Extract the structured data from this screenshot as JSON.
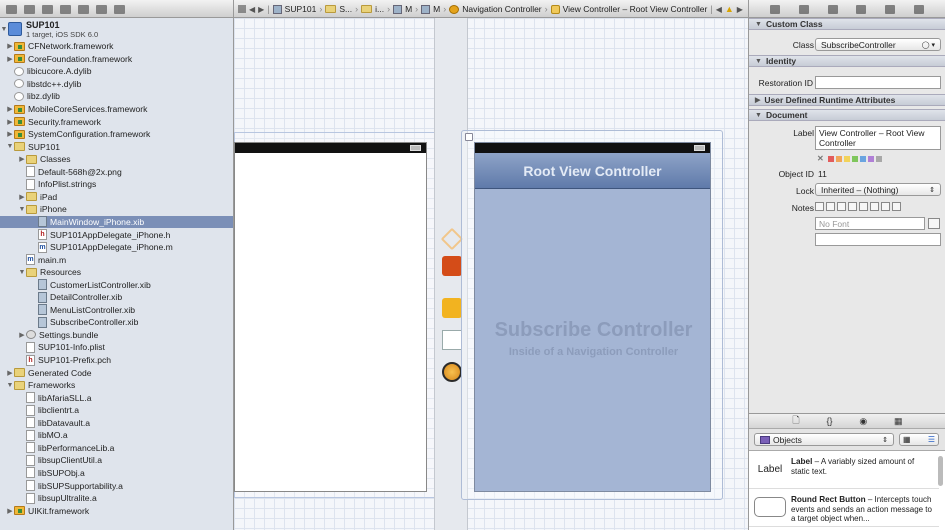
{
  "jumpbar": {
    "project": "SUP101",
    "crumb1": "S...",
    "crumb2": "i...",
    "crumb3": "M",
    "crumb4": "M",
    "crumb5": "Navigation Controller",
    "crumb6": "View Controller – Root View Controller"
  },
  "navigator": {
    "project_name": "SUP101",
    "project_sub": "1 target, iOS SDK 6.0",
    "items": [
      {
        "label": "CFNetwork.framework",
        "icon": "framework-icon",
        "indent": 1,
        "disc": "▶"
      },
      {
        "label": "CoreFoundation.framework",
        "icon": "framework-icon",
        "indent": 1,
        "disc": "▶"
      },
      {
        "label": "libicucore.A.dylib",
        "icon": "library-icon",
        "indent": 1,
        "disc": ""
      },
      {
        "label": "libstdc++.dylib",
        "icon": "library-icon",
        "indent": 1,
        "disc": ""
      },
      {
        "label": "libz.dylib",
        "icon": "library-icon",
        "indent": 1,
        "disc": ""
      },
      {
        "label": "MobileCoreServices.framework",
        "icon": "framework-icon",
        "indent": 1,
        "disc": "▶"
      },
      {
        "label": "Security.framework",
        "icon": "framework-icon",
        "indent": 1,
        "disc": "▶"
      },
      {
        "label": "SystemConfiguration.framework",
        "icon": "framework-icon",
        "indent": 1,
        "disc": "▶"
      },
      {
        "label": "SUP101",
        "icon": "folder-icon",
        "indent": 1,
        "disc": "▼"
      },
      {
        "label": "Classes",
        "icon": "folder-icon",
        "indent": 2,
        "disc": "▶"
      },
      {
        "label": "Default-568h@2x.png",
        "icon": "file-icon",
        "indent": 2,
        "disc": ""
      },
      {
        "label": "InfoPlist.strings",
        "icon": "file-icon",
        "indent": 2,
        "disc": ""
      },
      {
        "label": "iPad",
        "icon": "folder-icon",
        "indent": 2,
        "disc": "▶"
      },
      {
        "label": "iPhone",
        "icon": "folder-icon",
        "indent": 2,
        "disc": "▼"
      },
      {
        "label": "MainWindow_iPhone.xib",
        "icon": "xib-icon",
        "indent": 3,
        "disc": "",
        "selected": true
      },
      {
        "label": "SUP101AppDelegate_iPhone.h",
        "icon": "header-file-icon",
        "indent": 3,
        "disc": ""
      },
      {
        "label": "SUP101AppDelegate_iPhone.m",
        "icon": "source-file-icon",
        "indent": 3,
        "disc": ""
      },
      {
        "label": "main.m",
        "icon": "source-file-icon",
        "indent": 2,
        "disc": ""
      },
      {
        "label": "Resources",
        "icon": "folder-icon",
        "indent": 2,
        "disc": "▼"
      },
      {
        "label": "CustomerListController.xib",
        "icon": "xib-icon",
        "indent": 3,
        "disc": ""
      },
      {
        "label": "DetailController.xib",
        "icon": "xib-icon",
        "indent": 3,
        "disc": ""
      },
      {
        "label": "MenuListController.xib",
        "icon": "xib-icon",
        "indent": 3,
        "disc": ""
      },
      {
        "label": "SubscribeController.xib",
        "icon": "xib-icon",
        "indent": 3,
        "disc": ""
      },
      {
        "label": "Settings.bundle",
        "icon": "bundle-icon",
        "indent": 2,
        "disc": "▶"
      },
      {
        "label": "SUP101-Info.plist",
        "icon": "file-icon",
        "indent": 2,
        "disc": ""
      },
      {
        "label": "SUP101-Prefix.pch",
        "icon": "header-file-icon",
        "indent": 2,
        "disc": ""
      },
      {
        "label": "Generated Code",
        "icon": "folder-icon",
        "indent": 1,
        "disc": "▶"
      },
      {
        "label": "Frameworks",
        "icon": "folder-icon",
        "indent": 1,
        "disc": "▼"
      },
      {
        "label": "libAfariaSLL.a",
        "icon": "file-icon",
        "indent": 2,
        "disc": ""
      },
      {
        "label": "libclientrt.a",
        "icon": "file-icon",
        "indent": 2,
        "disc": ""
      },
      {
        "label": "libDatavault.a",
        "icon": "file-icon",
        "indent": 2,
        "disc": ""
      },
      {
        "label": "libMO.a",
        "icon": "file-icon",
        "indent": 2,
        "disc": ""
      },
      {
        "label": "libPerformanceLib.a",
        "icon": "file-icon",
        "indent": 2,
        "disc": ""
      },
      {
        "label": "libsupClientUtil.a",
        "icon": "file-icon",
        "indent": 2,
        "disc": ""
      },
      {
        "label": "libSUPObj.a",
        "icon": "file-icon",
        "indent": 2,
        "disc": ""
      },
      {
        "label": "libSUPSupportability.a",
        "icon": "file-icon",
        "indent": 2,
        "disc": ""
      },
      {
        "label": "libsupUltralite.a",
        "icon": "file-icon",
        "indent": 2,
        "disc": ""
      },
      {
        "label": "UIKit.framework",
        "icon": "framework-icon",
        "indent": 1,
        "disc": "▶"
      }
    ]
  },
  "canvas": {
    "navbar_title": "Root View Controller",
    "vc_title": "Subscribe Controller",
    "vc_subtitle": "Inside of a Navigation Controller"
  },
  "inspector": {
    "custom_class_header": "Custom Class",
    "class_label": "Class",
    "class_value": "SubscribeController",
    "identity_header": "Identity",
    "restoration_label": "Restoration ID",
    "restoration_value": "",
    "udra_header": "User Defined Runtime Attributes",
    "document_header": "Document",
    "doc_label_label": "Label",
    "doc_label_value": "View Controller – Root View Controller",
    "object_id_label": "Object ID",
    "object_id_value": "11",
    "lock_label": "Lock",
    "lock_value": "Inherited – (Nothing)",
    "notes_label": "Notes",
    "font_placeholder": "No Font",
    "chip_colors": [
      "#e25c5c",
      "#f0a65a",
      "#f2d35a",
      "#7fc65c",
      "#6aa4e0",
      "#b07fd6",
      "#a8a8a8"
    ]
  },
  "library": {
    "selector": "Objects",
    "items": [
      {
        "icon_text": "Label",
        "title": "Label",
        "desc": " – A variably sized amount of static text."
      },
      {
        "icon_text": "",
        "title": "Round Rect Button",
        "desc": " – Intercepts touch events and sends an action message to a target object when..."
      }
    ]
  }
}
